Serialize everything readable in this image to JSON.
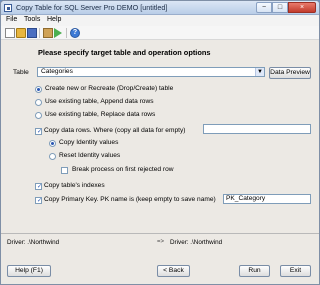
{
  "window": {
    "title": "Copy Table for SQL Server Pro DEMO [untitled]",
    "minimize_icon": "minimize-icon",
    "maximize_icon": "maximize-icon",
    "close_icon": "close-icon"
  },
  "menu": [
    "File",
    "Tools",
    "Help"
  ],
  "toolbar": [
    "new-file-icon",
    "open-folder-icon",
    "save-icon",
    "options-icon",
    "run-icon",
    "help-icon"
  ],
  "heading": "Please specify target table and operation options",
  "table": {
    "label": "Table",
    "selected": "Categories",
    "data_preview": "Data Preview"
  },
  "operation": {
    "create": "Create new or Recreate (Drop/Create) table",
    "append": "Use existing table, Append data rows",
    "replace": "Use existing table, Replace data rows"
  },
  "copy_rows": {
    "label": "Copy data rows. Where (copy all data for empty)",
    "value": "",
    "copy_identity": "Copy Identity values",
    "reset_identity": "Reset Identity values",
    "break_process": "Break process on first rejected row"
  },
  "copy_indexes": "Copy table's indexes",
  "primary_key": {
    "label": "Copy Primary Key. PK name is (keep empty to save name)",
    "value": "PK_Category"
  },
  "status": {
    "left": "Driver: .\\Northwind",
    "arrow": "=>",
    "right": "Driver: .\\Northwind"
  },
  "buttons": {
    "help": "Help (F1)",
    "back": "< Back",
    "run": "Run",
    "exit": "Exit"
  }
}
